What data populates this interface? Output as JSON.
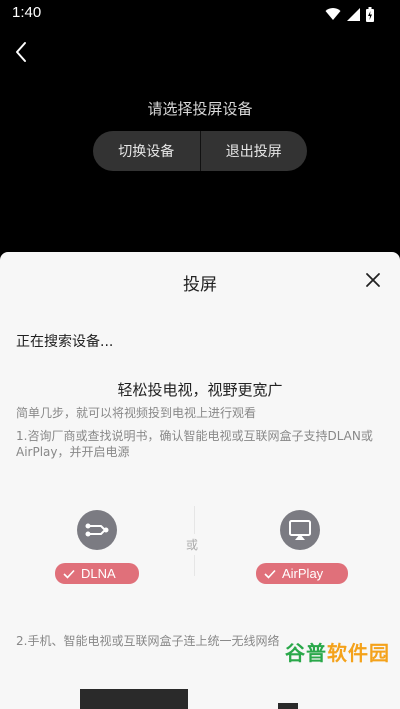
{
  "status_bar": {
    "time": "1:40"
  },
  "player": {
    "title": "请选择投屏设备",
    "switch_device_label": "切换设备",
    "exit_cast_label": "退出投屏"
  },
  "sheet": {
    "title": "投屏",
    "searching_text": "正在搜索设备...",
    "tip_heading": "轻松投电视，视野更宽广",
    "tip_sub": "简单几步，就可以将视频投到电视上进行观看",
    "step1": "1.咨询厂商或查找说明书，确认智能电视或互联网盒子支持DLAN或AirPlay，并开启电源",
    "dlna_label": "DLNA",
    "or_label": "或",
    "airplay_label": "AirPlay",
    "step2": "2.手机、智能电视或互联网盒子连上统一无线网络"
  },
  "watermark": {
    "part1": "谷普",
    "part2": "软件园"
  },
  "colors": {
    "accent": "#e0707a",
    "icon_bg": "#7b7b82",
    "sheet_bg": "#f7f7f7"
  }
}
